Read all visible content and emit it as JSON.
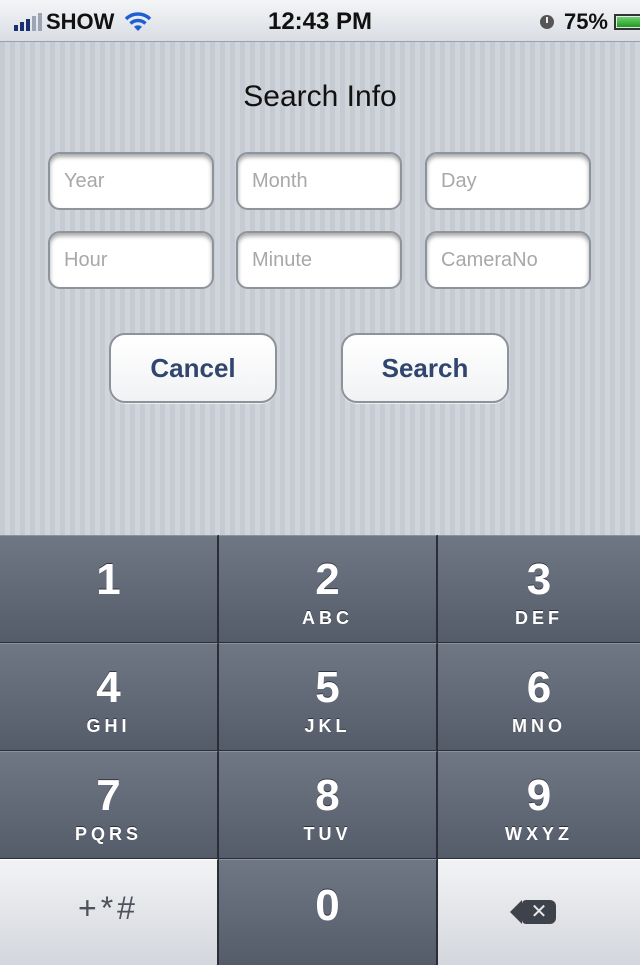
{
  "status_bar": {
    "carrier": "SHOW",
    "time": "12:43 PM",
    "battery_percent": "75%",
    "battery_level": 0.75
  },
  "form": {
    "title": "Search Info",
    "fields": [
      {
        "name": "year",
        "placeholder": "Year",
        "value": ""
      },
      {
        "name": "month",
        "placeholder": "Month",
        "value": ""
      },
      {
        "name": "day",
        "placeholder": "Day",
        "value": ""
      },
      {
        "name": "hour",
        "placeholder": "Hour",
        "value": ""
      },
      {
        "name": "minute",
        "placeholder": "Minute",
        "value": ""
      },
      {
        "name": "camera",
        "placeholder": "CameraNo",
        "value": ""
      }
    ],
    "cancel_label": "Cancel",
    "search_label": "Search"
  },
  "keypad": {
    "keys": [
      {
        "num": "1",
        "letters": ""
      },
      {
        "num": "2",
        "letters": "ABC"
      },
      {
        "num": "3",
        "letters": "DEF"
      },
      {
        "num": "4",
        "letters": "GHI"
      },
      {
        "num": "5",
        "letters": "JKL"
      },
      {
        "num": "6",
        "letters": "MNO"
      },
      {
        "num": "7",
        "letters": "PQRS"
      },
      {
        "num": "8",
        "letters": "TUV"
      },
      {
        "num": "9",
        "letters": "WXYZ"
      }
    ],
    "symbols_label": "+*#",
    "zero": "0",
    "delete_icon": "backspace-icon"
  }
}
